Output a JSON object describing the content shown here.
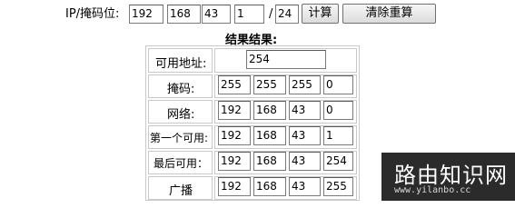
{
  "form": {
    "ip_label": "IP/掩码位:",
    "ip": [
      "192",
      "168",
      "43",
      "1"
    ],
    "slash": "/",
    "mask_bits": "24",
    "calc_button": "计算",
    "clear_button": "清除重算"
  },
  "result": {
    "title": "结果结果:",
    "usable_count_label": "可用地址:",
    "usable_count": "254",
    "rows": [
      {
        "label": "掩码:",
        "values": [
          "255",
          "255",
          "255",
          "0"
        ]
      },
      {
        "label": "网络:",
        "values": [
          "192",
          "168",
          "43",
          "0"
        ]
      },
      {
        "label": "第一个可用:",
        "values": [
          "192",
          "168",
          "43",
          "1"
        ]
      },
      {
        "label": "最后可用：",
        "values": [
          "192",
          "168",
          "43",
          "254"
        ]
      },
      {
        "label": "广播",
        "values": [
          "192",
          "168",
          "43",
          "255"
        ]
      }
    ]
  },
  "watermark": {
    "title": "路由知识网",
    "url": "www.yilanbo.cc"
  }
}
